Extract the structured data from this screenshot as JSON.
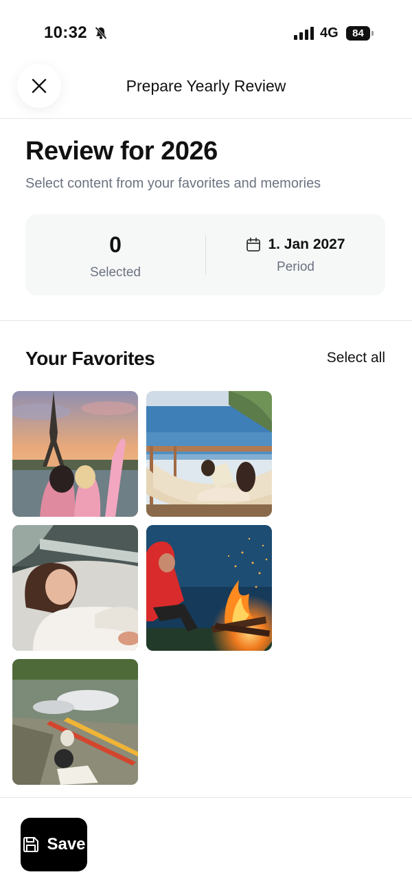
{
  "status_bar": {
    "time": "10:32",
    "network": "4G",
    "battery_level": "84",
    "icons": [
      "bell-muted-icon",
      "signal-icon"
    ]
  },
  "header": {
    "title": "Prepare Yearly Review",
    "close_icon": "close-icon"
  },
  "review": {
    "title": "Review for 2026",
    "subtitle": "Select content from your favorites and memories"
  },
  "stats": {
    "selected_count": "0",
    "selected_label": "Selected",
    "period_date": "1. Jan 2027",
    "period_label": "Period",
    "period_icon": "calendar-icon"
  },
  "favorites": {
    "title": "Your Favorites",
    "select_all_label": "Select all",
    "photos": [
      {
        "subject": "eiffel-tower-sunset"
      },
      {
        "subject": "hammock-by-sea"
      },
      {
        "subject": "woman-on-boat"
      },
      {
        "subject": "campfire-night"
      },
      {
        "subject": "kayaks-by-lake"
      }
    ]
  },
  "footer": {
    "save_label": "Save",
    "save_icon": "save-icon"
  },
  "colors": {
    "accent": "#000000",
    "muted_text": "#6b7280",
    "card_bg": "#f6f7f7"
  }
}
